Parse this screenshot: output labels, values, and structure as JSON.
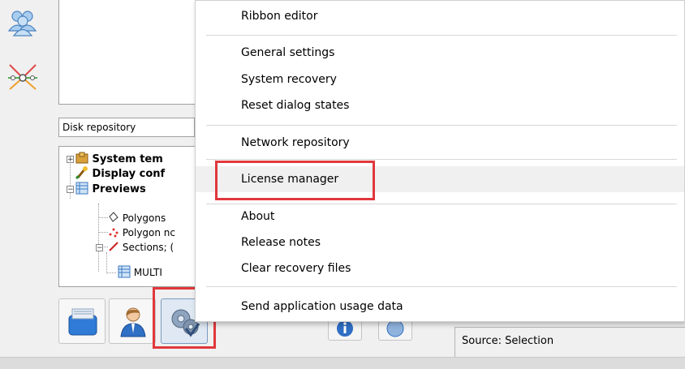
{
  "repository": {
    "selected": "Disk repository"
  },
  "tree": {
    "items": [
      {
        "label": "System tem",
        "bold": true
      },
      {
        "label": "Display conf",
        "bold": true
      },
      {
        "label": "Previews",
        "bold": true
      },
      {
        "label": "Polygons",
        "bold": false
      },
      {
        "label": "Polygon nc",
        "bold": false
      },
      {
        "label": "Sections; (",
        "bold": false
      },
      {
        "label": "MULTI",
        "bold": false
      }
    ]
  },
  "menu": {
    "items": [
      {
        "label": "Ribbon editor"
      },
      {
        "label": "General settings"
      },
      {
        "label": "System recovery"
      },
      {
        "label": "Reset dialog states"
      },
      {
        "label": "Network repository"
      },
      {
        "label": "License manager"
      },
      {
        "label": "About"
      },
      {
        "label": "Release notes"
      },
      {
        "label": "Clear recovery files"
      },
      {
        "label": "Send application usage data"
      }
    ],
    "hovered": "License manager"
  },
  "source_panel": {
    "text": "Source: Selection"
  },
  "colors": {
    "highlight": "#e0383c",
    "menu_hover": "#f0f0f0",
    "accent_blue": "#2f7bd6"
  },
  "icons": [
    "users-icon",
    "network-icon",
    "toolbox-icon",
    "user-icon",
    "settings-icon"
  ]
}
